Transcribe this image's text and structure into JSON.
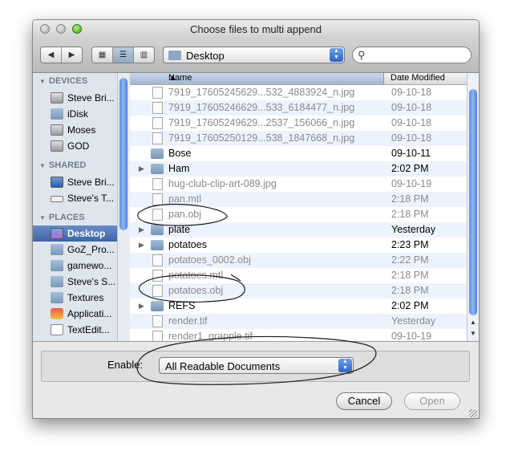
{
  "window": {
    "title": "Choose files to multi append"
  },
  "toolbar": {
    "back_icon": "chevron-left-icon",
    "forward_icon": "chevron-right-icon",
    "view_modes": [
      "icon-view-icon",
      "list-view-icon",
      "column-view-icon"
    ],
    "location": "Desktop",
    "search_value": ""
  },
  "sidebar": {
    "sections": [
      {
        "title": "DEVICES",
        "items": [
          "Steve Bri...",
          "iDisk",
          "Moses",
          "GOD"
        ]
      },
      {
        "title": "SHARED",
        "items": [
          "Steve Bri...",
          "Steve's T..."
        ]
      },
      {
        "title": "PLACES",
        "items": [
          "Desktop",
          "GoZ_Pro...",
          "gamewo...",
          "Steve's S...",
          "Textures",
          "Applicati...",
          "TextEdit..."
        ]
      }
    ],
    "selected": "Desktop"
  },
  "filelist": {
    "columns": {
      "name": "Name",
      "date": "Date Modified"
    },
    "rows": [
      {
        "name": "7919_17605245629...532_4883924_n.jpg",
        "date": "09-10-18",
        "kind": "doc",
        "enabled": false
      },
      {
        "name": "7919_17605246629...533_6184477_n.jpg",
        "date": "09-10-18",
        "kind": "doc",
        "enabled": false
      },
      {
        "name": "7919_17605249629...2537_156066_n.jpg",
        "date": "09-10-18",
        "kind": "doc",
        "enabled": false
      },
      {
        "name": "7919_17605250129...538_1847668_n.jpg",
        "date": "09-10-18",
        "kind": "doc",
        "enabled": false
      },
      {
        "name": "Bose",
        "date": "09-10-11",
        "kind": "folder",
        "enabled": true,
        "expandable": false
      },
      {
        "name": "Ham",
        "date": "2:02 PM",
        "kind": "folder",
        "enabled": true,
        "expandable": true
      },
      {
        "name": "hug-club-clip-art-089.jpg",
        "date": "09-10-19",
        "kind": "doc",
        "enabled": false
      },
      {
        "name": "pan.mtl",
        "date": "2:18 PM",
        "kind": "doc",
        "enabled": false
      },
      {
        "name": "pan.obj",
        "date": "2:18 PM",
        "kind": "doc",
        "enabled": false
      },
      {
        "name": "plate",
        "date": "Yesterday",
        "kind": "folder",
        "enabled": true,
        "expandable": true
      },
      {
        "name": "potatoes",
        "date": "2:23 PM",
        "kind": "folder",
        "enabled": true,
        "expandable": true
      },
      {
        "name": "potatoes_0002.obj",
        "date": "2:22 PM",
        "kind": "doc",
        "enabled": false
      },
      {
        "name": "potatoes.mtl",
        "date": "2:18 PM",
        "kind": "doc",
        "enabled": false
      },
      {
        "name": "potatoes.obj",
        "date": "2:18 PM",
        "kind": "doc",
        "enabled": false
      },
      {
        "name": "REFS",
        "date": "2:02 PM",
        "kind": "folder",
        "enabled": true,
        "expandable": true
      },
      {
        "name": "render.tif",
        "date": "Yesterday",
        "kind": "doc",
        "enabled": false
      },
      {
        "name": "render1_grapple.tif",
        "date": "09-10-19",
        "kind": "doc",
        "enabled": false
      }
    ]
  },
  "options": {
    "enable_label": "Enable:",
    "enable_value": "All Readable Documents"
  },
  "buttons": {
    "cancel": "Cancel",
    "open": "Open"
  }
}
